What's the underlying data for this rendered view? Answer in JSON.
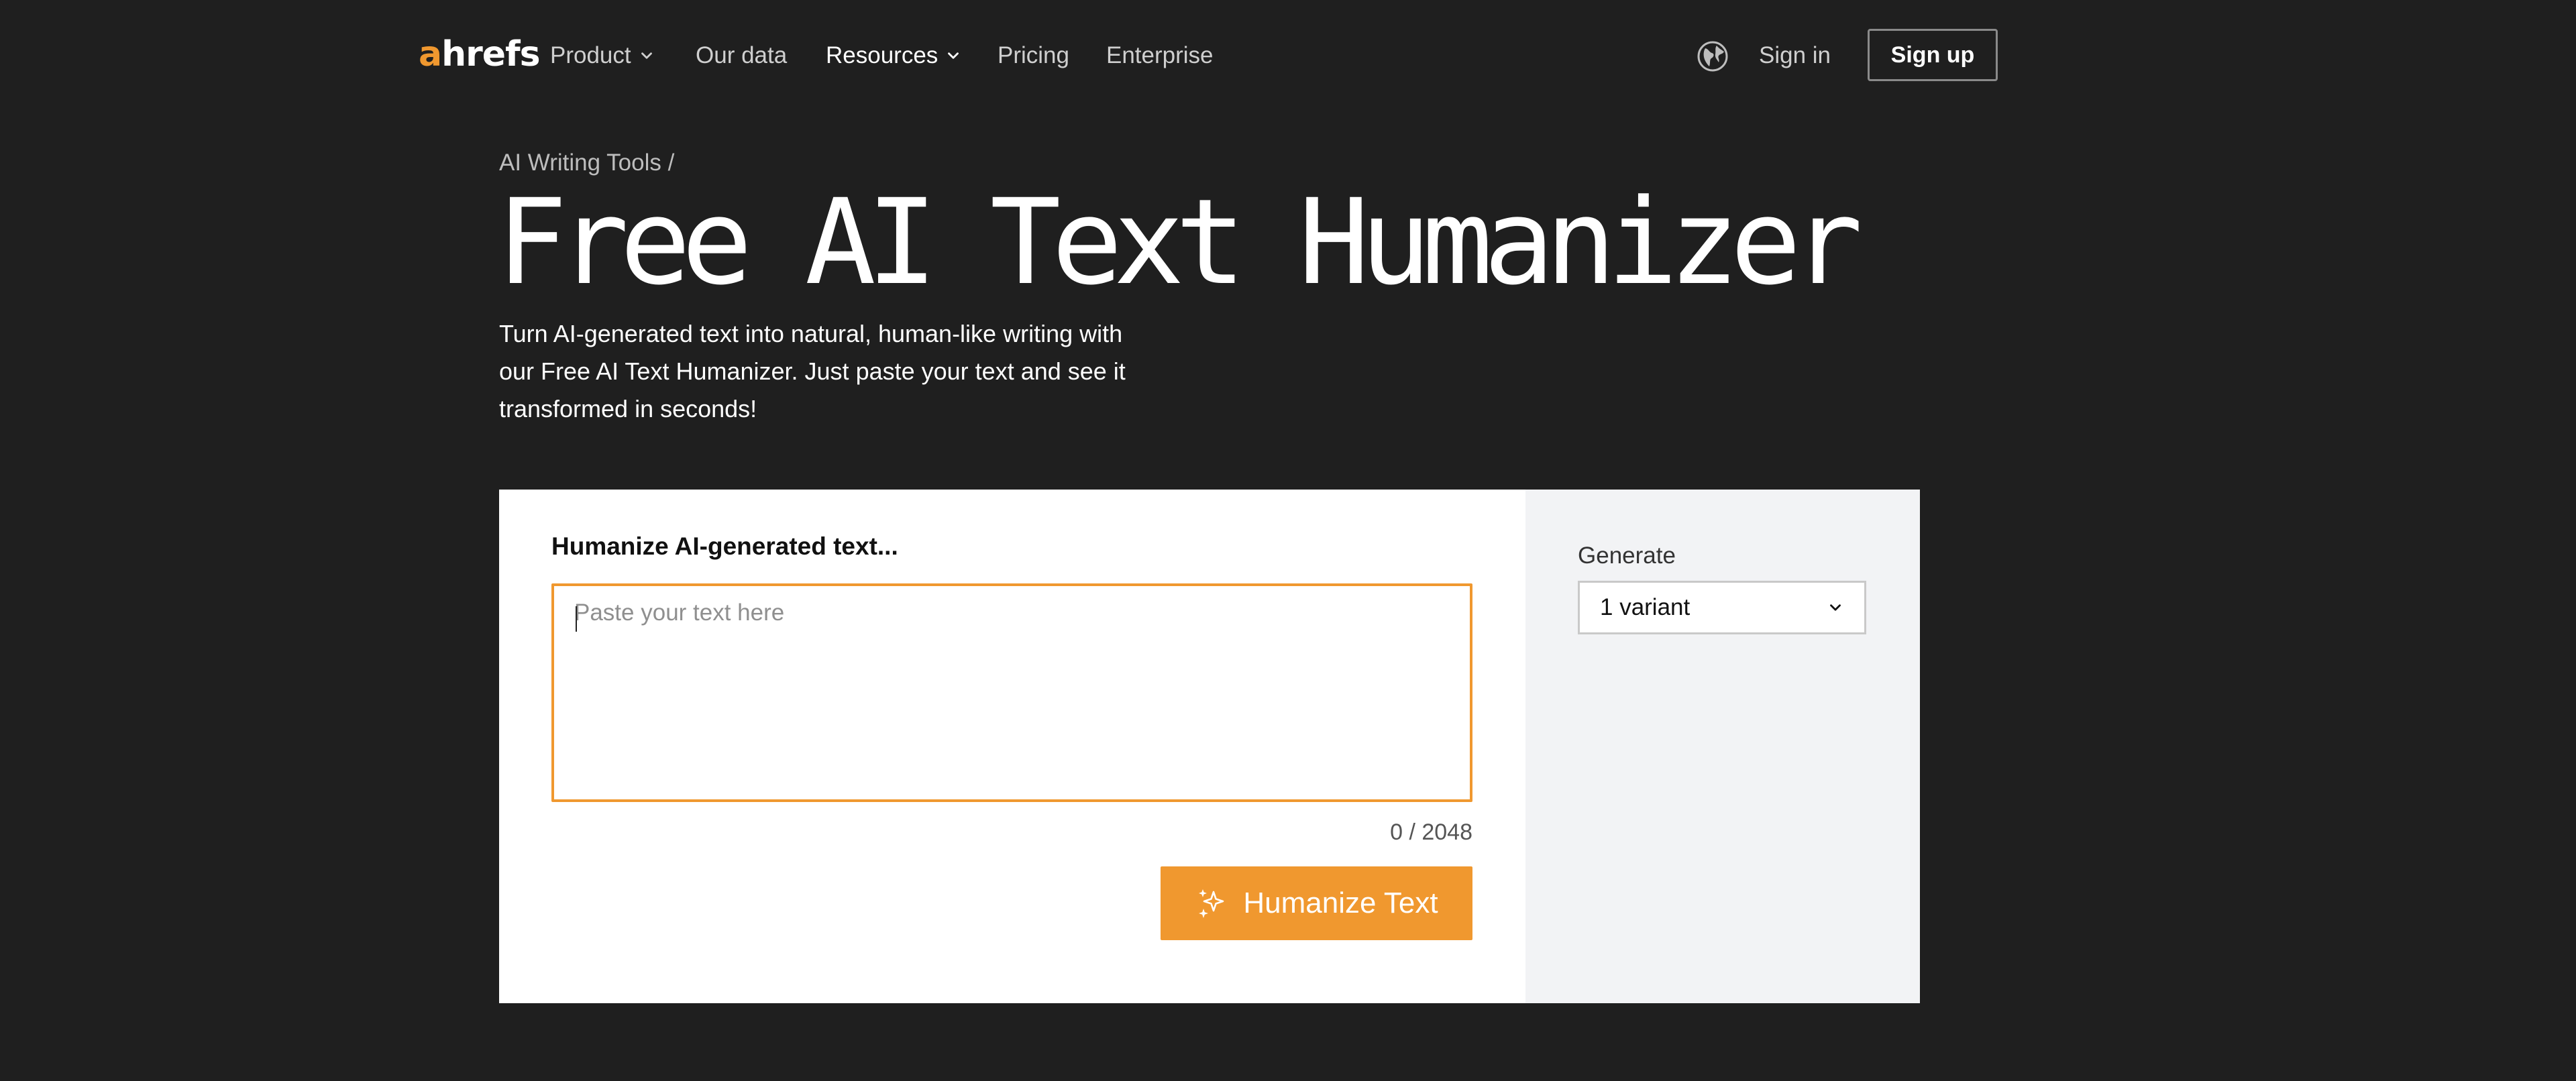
{
  "header": {
    "logo": {
      "accent": "a",
      "rest": "hrefs"
    },
    "nav": [
      {
        "label": "Product",
        "dropdown": true
      },
      {
        "label": "Our data",
        "dropdown": false
      },
      {
        "label": "Resources",
        "dropdown": true,
        "active": true
      },
      {
        "label": "Pricing",
        "dropdown": false
      },
      {
        "label": "Enterprise",
        "dropdown": false
      }
    ],
    "language_icon": "globe-icon",
    "sign_in": "Sign in",
    "sign_up": "Sign up"
  },
  "hero": {
    "breadcrumb": "AI Writing Tools /",
    "title": "Free AI Text Humanizer",
    "subtitle": "Turn AI-generated text into natural, human-like writing with our Free AI Text Humanizer. Just paste your text and see it transformed in seconds!"
  },
  "tool": {
    "input_label": "Humanize AI-generated text...",
    "placeholder": "Paste your text here",
    "value": "",
    "counter": "0 / 2048",
    "button_label": "Humanize Text",
    "button_icon": "sparkles-icon",
    "generate_label": "Generate",
    "variant_selected": "1 variant"
  },
  "colors": {
    "background": "#1f1f1f",
    "accent": "#f0982f",
    "panel": "#f2f3f5",
    "card": "#ffffff"
  }
}
